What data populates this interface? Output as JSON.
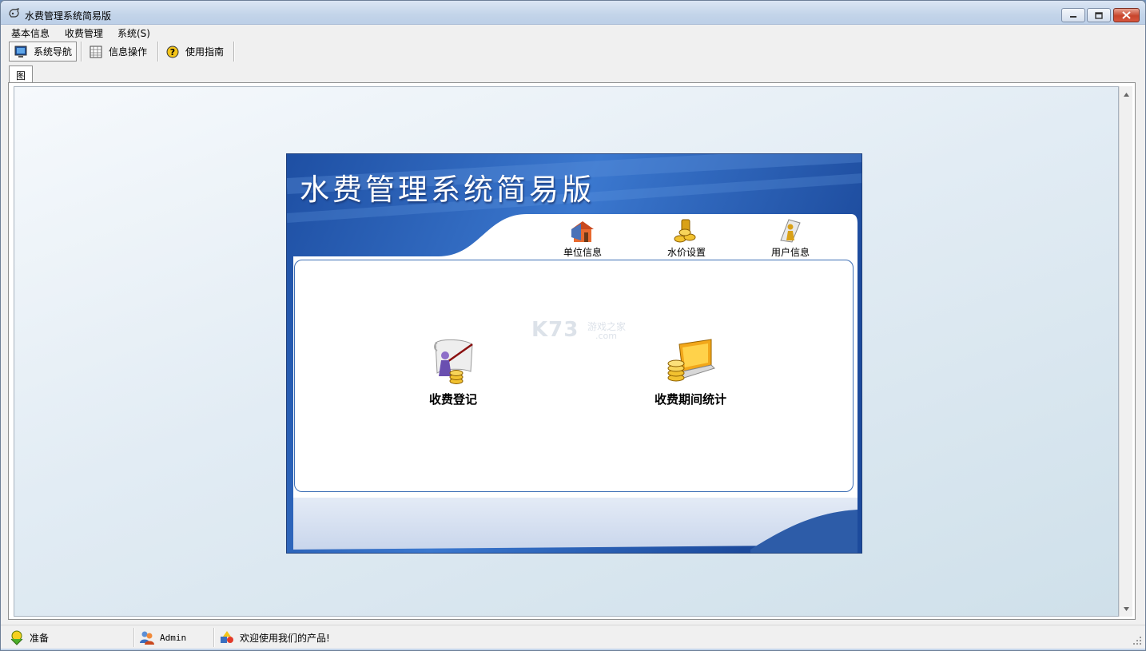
{
  "window": {
    "title": "水费管理系统简易版",
    "icon": "app-icon"
  },
  "menubar": {
    "items": [
      "基本信息",
      "收费管理",
      "系统(S)"
    ]
  },
  "toolbar": {
    "items": [
      {
        "label": "系统导航",
        "icon": "monitor-icon",
        "active": true
      },
      {
        "label": "信息操作",
        "icon": "grid-icon",
        "active": false
      },
      {
        "label": "使用指南",
        "icon": "help-icon",
        "active": false
      }
    ]
  },
  "tabs": {
    "active": "图文导航"
  },
  "panel": {
    "title": "水费管理系统简易版",
    "top_nav": [
      {
        "label": "单位信息",
        "icon": "building-icon"
      },
      {
        "label": "水价设置",
        "icon": "coins-icon"
      },
      {
        "label": "用户信息",
        "icon": "user-pencil-icon"
      }
    ],
    "main_nav": [
      {
        "label": "收费登记",
        "icon": "register-icon"
      },
      {
        "label": "收费期间统计",
        "icon": "statistics-icon"
      }
    ],
    "watermark": {
      "main": "K73",
      "sub": "游戏之家",
      "domain": ".com"
    }
  },
  "statusbar": {
    "status": "准备",
    "user": "Admin",
    "message": "欢迎使用我们的产品!"
  },
  "colors": {
    "titlebar": "#c3d4e9",
    "panel_blue": "#2d5ca8",
    "close_button": "#c8452c"
  }
}
